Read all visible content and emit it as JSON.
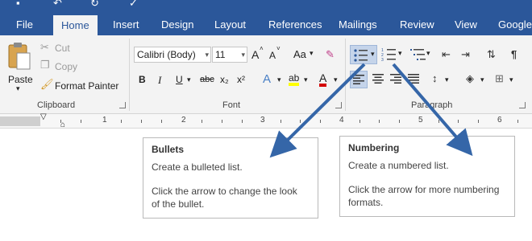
{
  "quick_access": {
    "icons": [
      "save-icon",
      "undo-icon",
      "redo-icon",
      "checkmark-icon"
    ]
  },
  "tabs": [
    {
      "label": "File"
    },
    {
      "label": "Home"
    },
    {
      "label": "Insert"
    },
    {
      "label": "Design"
    },
    {
      "label": "Layout"
    },
    {
      "label": "References"
    },
    {
      "label": "Mailings"
    },
    {
      "label": "Review"
    },
    {
      "label": "View"
    },
    {
      "label": "Google"
    }
  ],
  "active_tab": "Home",
  "clipboard": {
    "paste": "Paste",
    "cut": "Cut",
    "copy": "Copy",
    "format_painter": "Format Painter",
    "group_label": "Clipboard"
  },
  "font": {
    "font_name": "Calibri (Body)",
    "font_size": "11",
    "grow": "A",
    "shrink": "A",
    "change_case": "Aa",
    "bold": "B",
    "italic": "I",
    "underline": "U",
    "strikethrough": "abc",
    "subscript": "x₂",
    "superscript": "x²",
    "text_effects": "A",
    "highlight": "ab",
    "font_color": "A",
    "group_label": "Font"
  },
  "paragraph": {
    "group_label": "Paragraph"
  },
  "ruler": {
    "numbers": [
      "1",
      "2",
      "3",
      "4",
      "5",
      "6"
    ]
  },
  "tooltips": {
    "bullets": {
      "title": "Bullets",
      "line1": "Create a bulleted list.",
      "line2": "Click the arrow to change the look",
      "line3": "of the bullet."
    },
    "numbering": {
      "title": "Numbering",
      "line1": "Create a numbered list.",
      "line2": "Click the arrow for more numbering",
      "line3": "formats."
    }
  },
  "colors": {
    "ribbon_blue": "#2b579a",
    "highlight_yellow": "#ffff00",
    "font_red": "#d40000",
    "arrow_blue": "#3566a8"
  }
}
